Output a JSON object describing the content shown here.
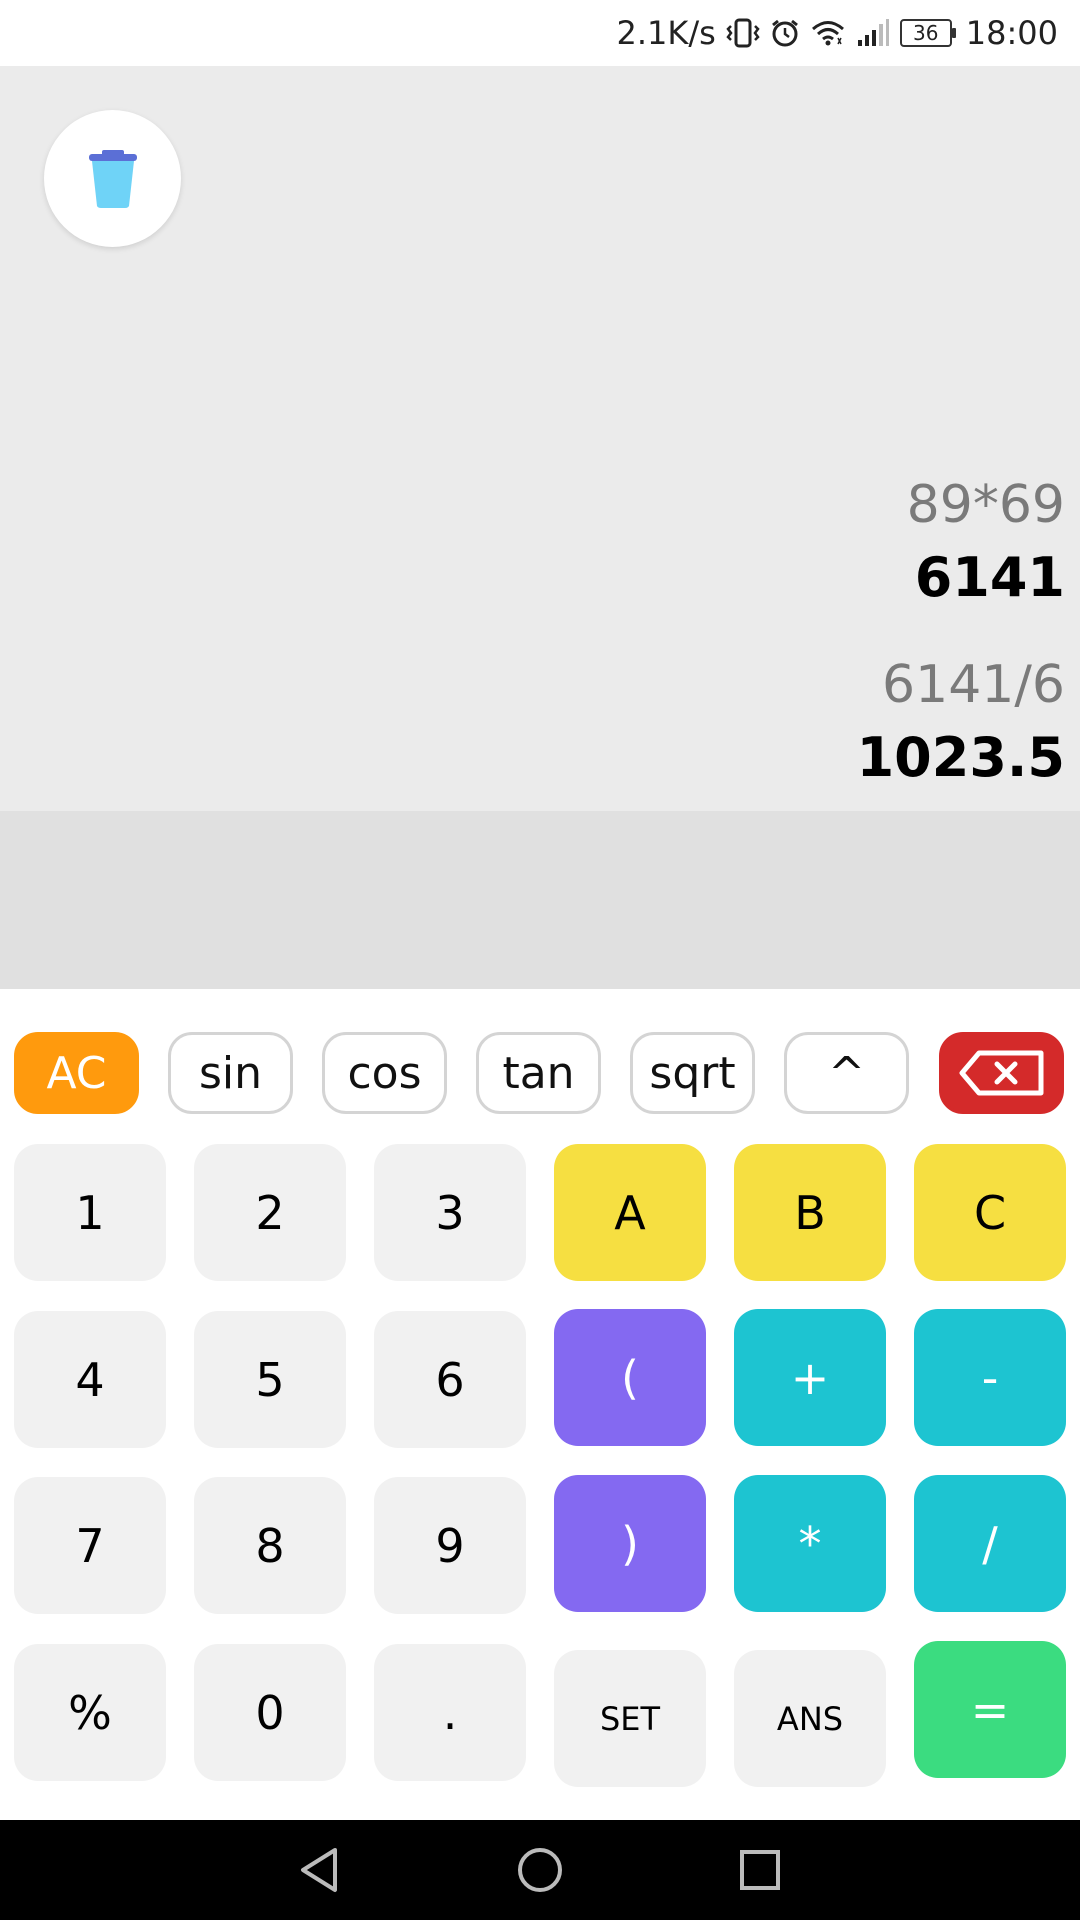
{
  "status_bar": {
    "speed": "2.1K/s",
    "battery": "36",
    "time": "18:00",
    "icons": [
      "vibrate-icon",
      "alarm-icon",
      "wifi-icon",
      "signal-icon",
      "battery-icon"
    ]
  },
  "history": [
    {
      "expression": "89*69",
      "result": "6141"
    },
    {
      "expression": "6141/6",
      "result": "1023.5"
    }
  ],
  "input": "",
  "functions": [
    "AC",
    "sin",
    "cos",
    "tan",
    "sqrt",
    "^"
  ],
  "keys": {
    "row1": [
      "1",
      "2",
      "3",
      "A",
      "B",
      "C"
    ],
    "row2": [
      "4",
      "5",
      "6",
      "(",
      "+",
      "-"
    ],
    "row3": [
      "7",
      "8",
      "9",
      ")",
      "*",
      "/"
    ],
    "row4": [
      "%",
      "0",
      ".",
      "SET",
      "ANS",
      "="
    ]
  },
  "colors": {
    "ac": "#ff9a0d",
    "delete": "#d42a2a",
    "variable_keys": "#f6df41",
    "paren_keys": "#8469f1",
    "operator_keys": "#1dc4d1",
    "equals_key": "#3bdc80",
    "number_keys": "#f1f1f1"
  }
}
